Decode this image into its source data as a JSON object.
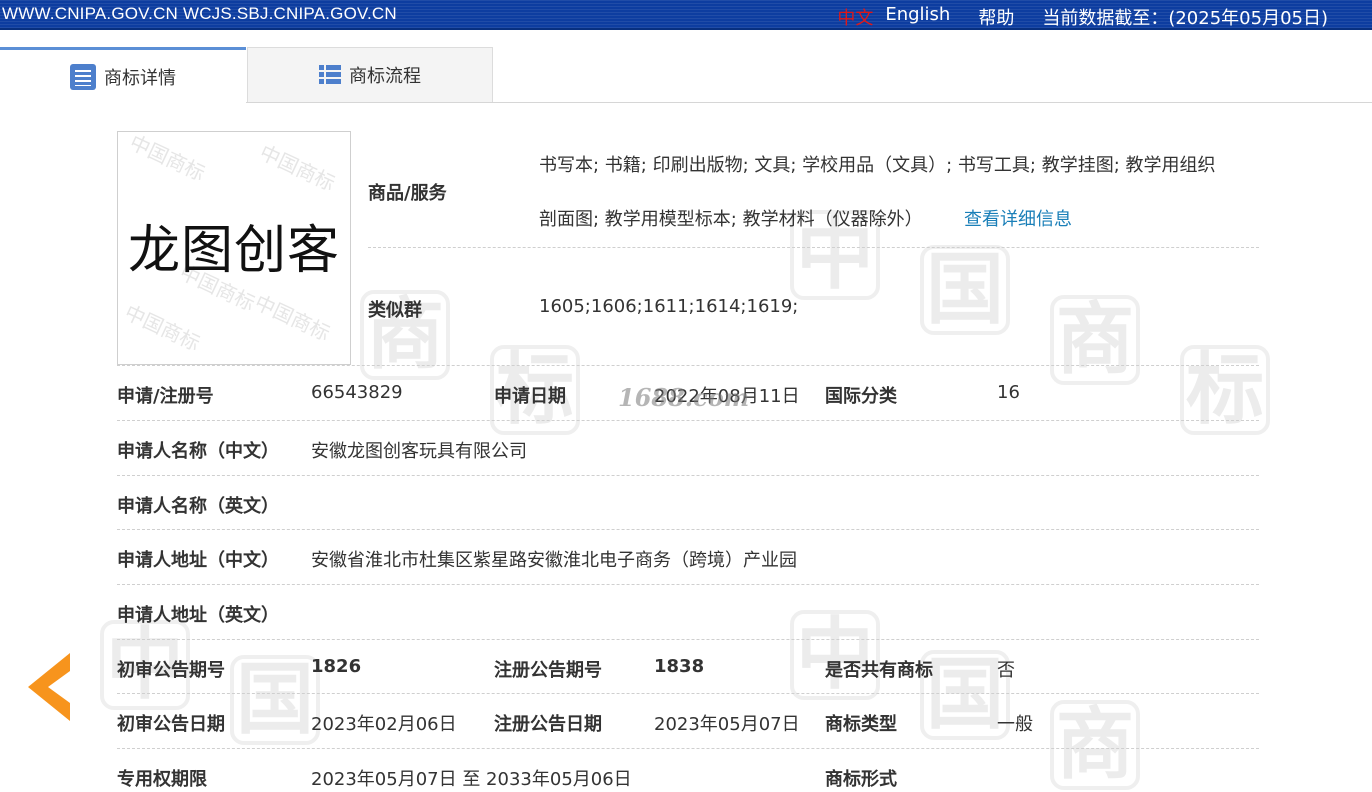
{
  "topbar": {
    "sites": "WWW.CNIPA.GOV.CN WCJS.SBJ.CNIPA.GOV.CN",
    "lang_zh": "中文",
    "lang_en": "English",
    "help": "帮助",
    "data_cutoff": "当前数据截至：(2025年05月05日)"
  },
  "tabs": [
    {
      "label": "商标详情",
      "icon": "document-list-icon",
      "active": true
    },
    {
      "label": "商标流程",
      "icon": "list-icon",
      "active": false
    }
  ],
  "trademark": {
    "image_text": "龙图创客",
    "goods_label": "商品/服务",
    "goods_line1": "书写本; 书籍; 印刷出版物; 文具; 学校用品（文具）; 书写工具; 教学挂图; 教学用组织",
    "goods_line2": "剖面图; 教学用模型标本; 教学材料（仪器除外）",
    "goods_more": "查看详细信息",
    "similar_label": "类似群",
    "similar_value": "1605;1606;1611;1614;1619;"
  },
  "details": {
    "reg_no_label": "申请/注册号",
    "reg_no": "66543829",
    "app_date_label": "申请日期",
    "app_date": "2022年08月11日",
    "intl_class_label": "国际分类",
    "intl_class": "16",
    "applicant_cn_label": "申请人名称（中文）",
    "applicant_cn": "安徽龙图创客玩具有限公司",
    "applicant_en_label": "申请人名称（英文）",
    "applicant_en": "",
    "address_cn_label": "申请人地址（中文）",
    "address_cn": "安徽省淮北市杜集区紫星路安徽淮北电子商务（跨境）产业园",
    "address_en_label": "申请人地址（英文）",
    "address_en": "",
    "prelim_issue_label": "初审公告期号",
    "prelim_issue": "1826",
    "reg_issue_label": "注册公告期号",
    "reg_issue": "1838",
    "shared_label": "是否共有商标",
    "shared": "否",
    "prelim_date_label": "初审公告日期",
    "prelim_date": "2023年02月06日",
    "reg_date_label": "注册公告日期",
    "reg_date": "2023年05月07日",
    "tm_type_label": "商标类型",
    "tm_type": "一般",
    "exclusive_label": "专用权期限",
    "exclusive": "2023年05月07日 至 2033年05月06日",
    "tm_form_label": "商标形式",
    "tm_form": ""
  },
  "overlay_stamp": "1688.com",
  "colors": {
    "topbar": "#0d3da0",
    "accent_link": "#1a7fb8",
    "back_arrow": "#f7941d",
    "tab_icon": "#4d7fcc"
  }
}
